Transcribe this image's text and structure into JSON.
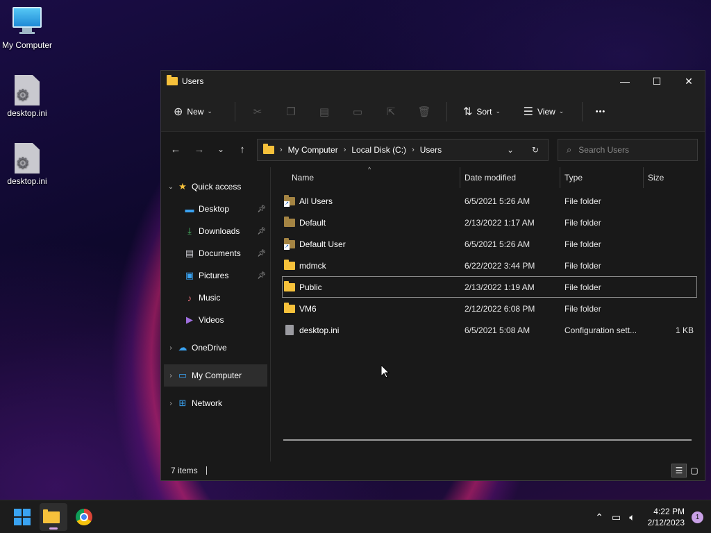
{
  "desktop": {
    "icons": [
      {
        "label": "My Computer"
      },
      {
        "label": "desktop.ini"
      },
      {
        "label": "desktop.ini"
      }
    ]
  },
  "window": {
    "title": "Users",
    "controls": {
      "minimize": "—",
      "maximize": "☐",
      "close": "✕"
    }
  },
  "toolbar": {
    "new_label": "New",
    "sort_label": "Sort",
    "view_label": "View",
    "more_label": "•••"
  },
  "address": {
    "crumbs": [
      "My Computer",
      "Local Disk (C:)",
      "Users"
    ]
  },
  "search": {
    "placeholder": "Search Users"
  },
  "navpane": {
    "quick_access": "Quick access",
    "items": [
      {
        "label": "Desktop"
      },
      {
        "label": "Downloads"
      },
      {
        "label": "Documents"
      },
      {
        "label": "Pictures"
      },
      {
        "label": "Music"
      },
      {
        "label": "Videos"
      }
    ],
    "onedrive": "OneDrive",
    "my_computer": "My Computer",
    "network": "Network"
  },
  "columns": {
    "name": "Name",
    "date": "Date modified",
    "type": "Type",
    "size": "Size"
  },
  "files": [
    {
      "name": "All Users",
      "date": "6/5/2021 5:26 AM",
      "type": "File folder",
      "size": ""
    },
    {
      "name": "Default",
      "date": "2/13/2022 1:17 AM",
      "type": "File folder",
      "size": ""
    },
    {
      "name": "Default User",
      "date": "6/5/2021 5:26 AM",
      "type": "File folder",
      "size": ""
    },
    {
      "name": "mdmck",
      "date": "6/22/2022 3:44 PM",
      "type": "File folder",
      "size": ""
    },
    {
      "name": "Public",
      "date": "2/13/2022 1:19 AM",
      "type": "File folder",
      "size": ""
    },
    {
      "name": "VM6",
      "date": "2/12/2022 6:08 PM",
      "type": "File folder",
      "size": ""
    },
    {
      "name": "desktop.ini",
      "date": "6/5/2021 5:08 AM",
      "type": "Configuration sett...",
      "size": "1 KB"
    }
  ],
  "status": {
    "items": "7 items"
  },
  "taskbar": {
    "time": "4:22 PM",
    "date": "2/12/2023",
    "notifications": "1"
  },
  "colors": {
    "folder": "#f6c13b",
    "accent": "#3aa3f2",
    "window_bg": "#191919"
  }
}
